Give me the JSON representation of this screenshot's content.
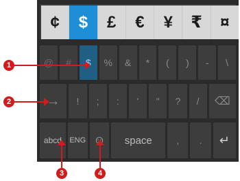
{
  "popup_keys": [
    "¢",
    "$",
    "£",
    "€",
    "¥",
    "₹",
    "¤"
  ],
  "popup_active_index": 1,
  "left_hint": "1",
  "row2_keys": [
    "@",
    "#",
    "$",
    "%",
    "&",
    "*",
    "(",
    ")",
    "-",
    "\\"
  ],
  "row2_selected_index": 2,
  "row3": {
    "tab_glyph": "→",
    "keys": [
      "!",
      ";",
      ":",
      "'",
      "\"",
      "?",
      "/"
    ],
    "backspace_glyph": "⌫"
  },
  "row4": {
    "abcd_label": "abcd",
    "lang_label": "ENG",
    "emoji_glyph": "☺",
    "space_label": "space",
    "comma_label": ",",
    "period_label": ".",
    "enter_glyph": "↵"
  },
  "callouts": [
    "1",
    "2",
    "3",
    "4"
  ],
  "colors": {
    "callout": "#d01c1c",
    "active_popup": "#1e8fd6",
    "selected_key": "#1f5f83"
  }
}
